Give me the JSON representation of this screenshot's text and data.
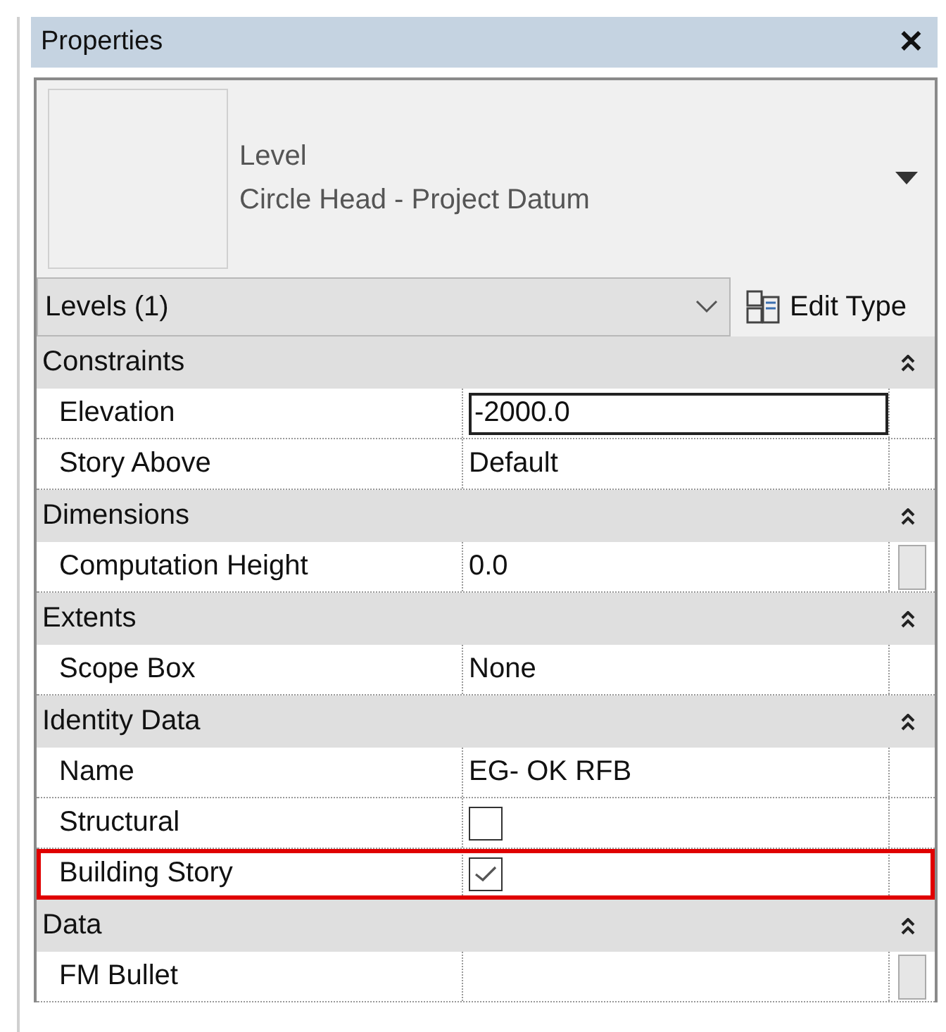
{
  "window": {
    "title": "Properties",
    "close": "✕"
  },
  "type_selector": {
    "family": "Level",
    "type": "Circle Head - Project Datum"
  },
  "filter": {
    "value": "Levels (1)"
  },
  "edit_type": {
    "label": "Edit Type"
  },
  "groups": [
    {
      "title": "Constraints",
      "expanded": true,
      "rows": [
        {
          "label": "Elevation",
          "kind": "input",
          "value": "-2000.0",
          "has_button": false,
          "highlighted": false
        },
        {
          "label": "Story Above",
          "kind": "text",
          "value": "Default",
          "has_button": false,
          "highlighted": false
        }
      ]
    },
    {
      "title": "Dimensions",
      "expanded": true,
      "rows": [
        {
          "label": "Computation Height",
          "kind": "text",
          "value": "0.0",
          "has_button": true,
          "highlighted": false
        }
      ]
    },
    {
      "title": "Extents",
      "expanded": true,
      "rows": [
        {
          "label": "Scope Box",
          "kind": "text",
          "value": "None",
          "has_button": false,
          "highlighted": false
        }
      ]
    },
    {
      "title": "Identity Data",
      "expanded": true,
      "rows": [
        {
          "label": "Name",
          "kind": "text",
          "value": "EG- OK RFB",
          "has_button": false,
          "highlighted": false
        },
        {
          "label": "Structural",
          "kind": "checkbox",
          "checked": false,
          "has_button": false,
          "highlighted": false
        },
        {
          "label": "Building Story",
          "kind": "checkbox",
          "checked": true,
          "has_button": false,
          "highlighted": true
        }
      ]
    },
    {
      "title": "Data",
      "expanded": true,
      "rows": [
        {
          "label": "FM Bullet",
          "kind": "text",
          "value": "",
          "has_button": true,
          "highlighted": false
        }
      ]
    }
  ]
}
